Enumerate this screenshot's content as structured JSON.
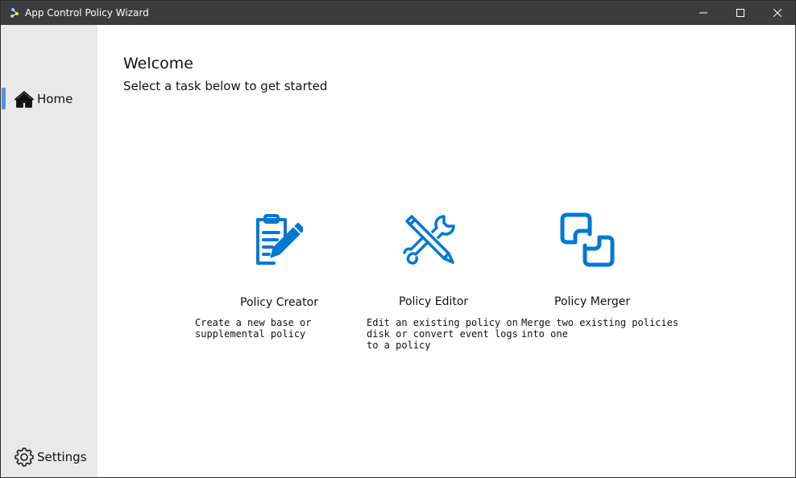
{
  "window": {
    "title": "App Control Policy Wizard"
  },
  "sidebar": {
    "items": [
      {
        "label": "Home",
        "icon": "home-icon",
        "selected": true
      },
      {
        "label": "Settings",
        "icon": "gear-icon",
        "selected": false
      }
    ]
  },
  "main": {
    "title": "Welcome",
    "subtitle": "Select a task below to get started",
    "cards": [
      {
        "title": "Policy Creator",
        "description": "Create a new base or supplemental policy",
        "icon": "clipboard-pencil-icon"
      },
      {
        "title": "Policy Editor",
        "description": "Edit an existing policy on disk or convert event logs to a policy",
        "icon": "wrench-pencil-icon"
      },
      {
        "title": "Policy Merger",
        "description": "Merge two existing policies into one",
        "icon": "merge-squares-icon"
      }
    ]
  },
  "colors": {
    "accent": "#0078d4",
    "titlebar": "#3c3c3c",
    "sidebar": "#e9e9e9",
    "selection_indicator": "#5b8fd6"
  }
}
